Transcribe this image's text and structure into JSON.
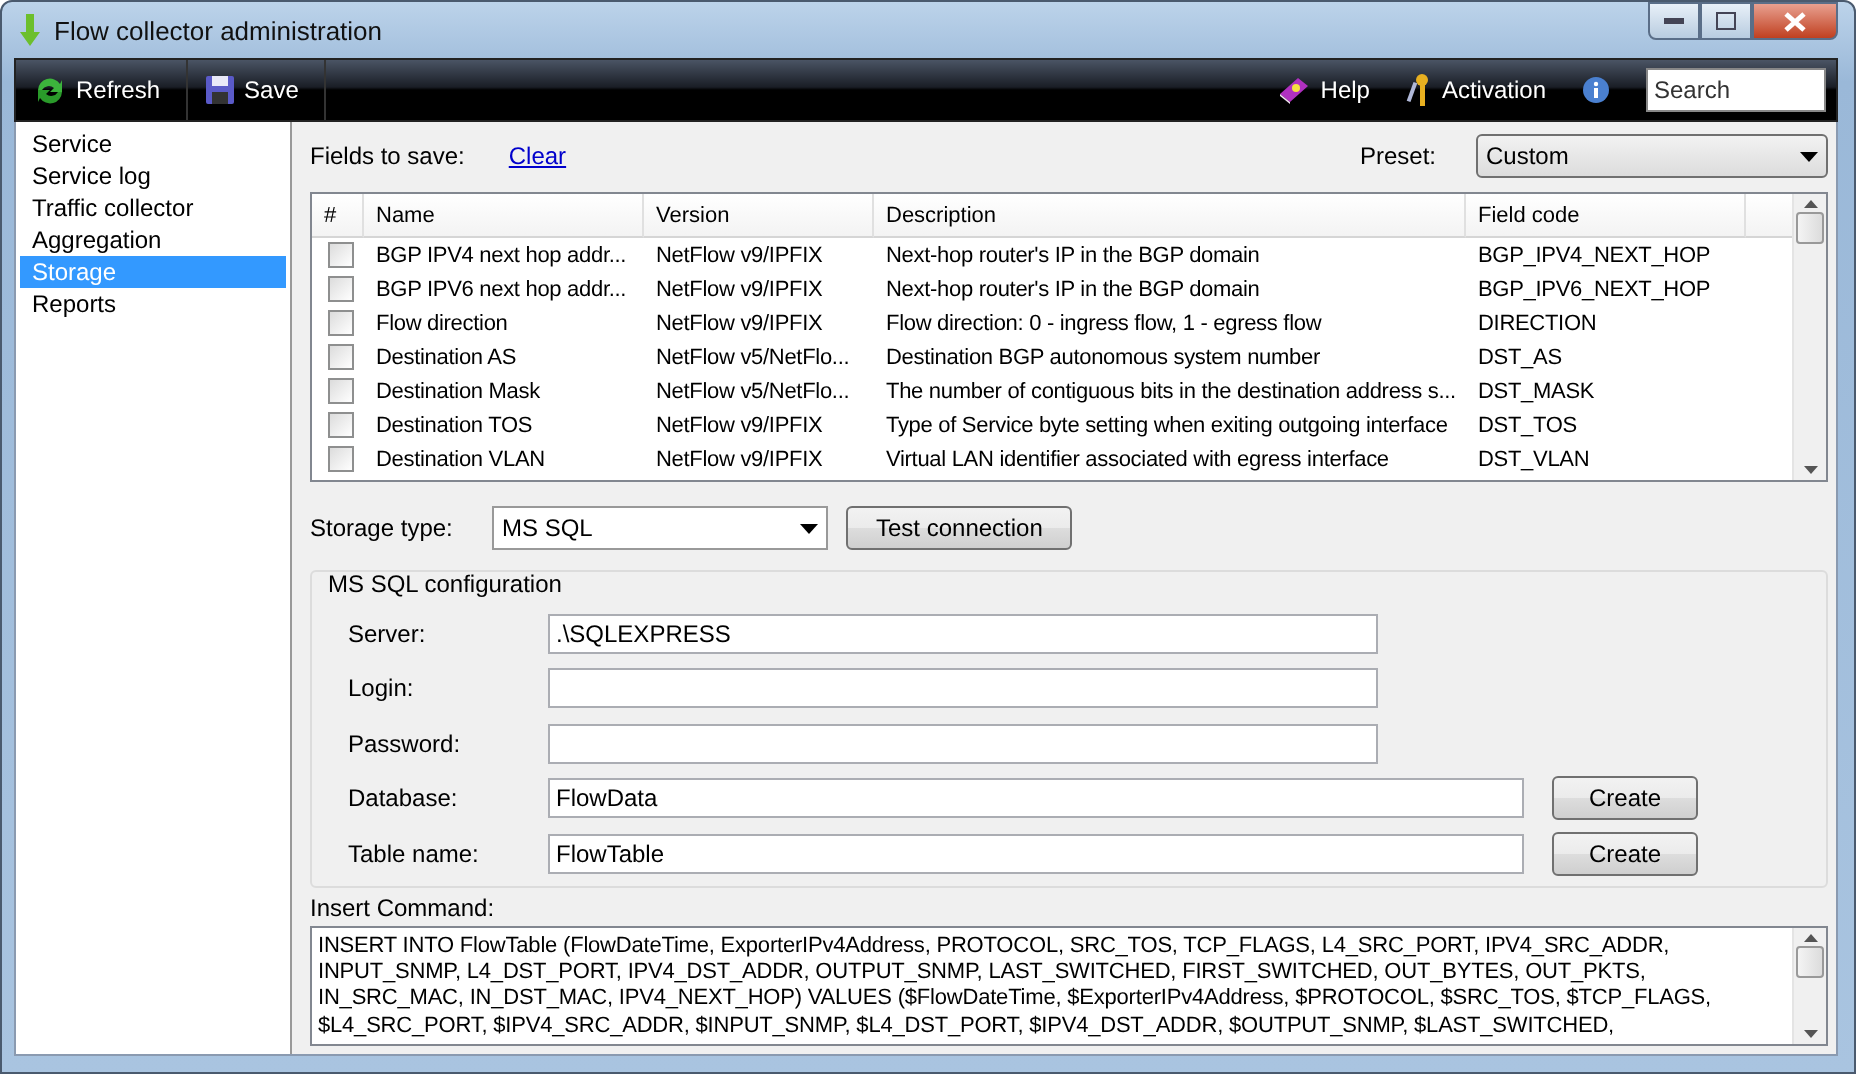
{
  "window": {
    "title": "Flow collector administration"
  },
  "toolbar": {
    "left": [
      {
        "kind": "refresh",
        "label": "Refresh"
      },
      {
        "kind": "save",
        "label": "Save"
      }
    ],
    "right": [
      {
        "kind": "help",
        "label": "Help"
      },
      {
        "kind": "activation",
        "label": "Activation"
      },
      {
        "kind": "info"
      }
    ],
    "search": {
      "placeholder": "Search"
    }
  },
  "sidebar": {
    "items": [
      {
        "label": "Service",
        "selected": false
      },
      {
        "label": "Service log",
        "selected": false
      },
      {
        "label": "Traffic collector",
        "selected": false
      },
      {
        "label": "Aggregation",
        "selected": false
      },
      {
        "label": "Storage",
        "selected": true
      },
      {
        "label": "Reports",
        "selected": false
      }
    ]
  },
  "fields": {
    "label": "Fields to save:",
    "clear": "Clear",
    "preset_label": "Preset:",
    "preset": "Custom"
  },
  "table": {
    "check_header": "#",
    "columns": [
      "Name",
      "Version",
      "Description",
      "Field code"
    ],
    "rows": [
      {
        "checked": false,
        "cells": [
          "BGP IPV4 next hop addr...",
          "NetFlow v9/IPFIX",
          "Next-hop router's IP in the BGP domain",
          "BGP_IPV4_NEXT_HOP"
        ]
      },
      {
        "checked": false,
        "cells": [
          "BGP IPV6 next hop addr...",
          "NetFlow v9/IPFIX",
          "Next-hop router's IP in the BGP domain",
          "BGP_IPV6_NEXT_HOP"
        ]
      },
      {
        "checked": false,
        "cells": [
          "Flow direction",
          "NetFlow v9/IPFIX",
          "Flow direction: 0 - ingress flow, 1 - egress flow",
          "DIRECTION"
        ]
      },
      {
        "checked": false,
        "cells": [
          "Destination AS",
          "NetFlow v5/NetFlo...",
          "Destination BGP autonomous system number",
          "DST_AS"
        ]
      },
      {
        "checked": false,
        "cells": [
          "Destination Mask",
          "NetFlow v5/NetFlo...",
          "The number of contiguous bits in the destination address s...",
          "DST_MASK"
        ]
      },
      {
        "checked": false,
        "cells": [
          "Destination TOS",
          "NetFlow v9/IPFIX",
          "Type of Service byte setting when exiting outgoing interface",
          "DST_TOS"
        ]
      },
      {
        "checked": false,
        "cells": [
          "Destination VLAN",
          "NetFlow v9/IPFIX",
          "Virtual LAN identifier associated with egress interface",
          "DST_VLAN"
        ]
      }
    ]
  },
  "storage": {
    "label": "Storage type:",
    "value": "MS SQL",
    "test": "Test connection"
  },
  "config": {
    "title": "MS SQL configuration",
    "fields": [
      {
        "label": "Server:",
        "value": ".\\SQLEXPRESS"
      },
      {
        "label": "Login:"
      },
      {
        "label": "Password:"
      },
      {
        "label": "Database:",
        "value": "FlowData",
        "action": "Create"
      },
      {
        "label": "Table name:",
        "value": "FlowTable",
        "action": "Create"
      }
    ]
  },
  "insert": {
    "label": "Insert Command:",
    "lines": [
      "INSERT INTO FlowTable (FlowDateTime, ExporterIPv4Address, PROTOCOL, SRC_TOS, TCP_FLAGS, L4_SRC_PORT, IPV4_SRC_ADDR,",
      "INPUT_SNMP, L4_DST_PORT, IPV4_DST_ADDR, OUTPUT_SNMP, LAST_SWITCHED, FIRST_SWITCHED, OUT_BYTES, OUT_PKTS,",
      "IN_SRC_MAC, IN_DST_MAC, IPV4_NEXT_HOP) VALUES ($FlowDateTime, $ExporterIPv4Address, $PROTOCOL, $SRC_TOS, $TCP_FLAGS,",
      "$L4_SRC_PORT, $IPV4_SRC_ADDR, $INPUT_SNMP, $L4_DST_PORT, $IPV4_DST_ADDR, $OUTPUT_SNMP, $LAST_SWITCHED,"
    ]
  }
}
